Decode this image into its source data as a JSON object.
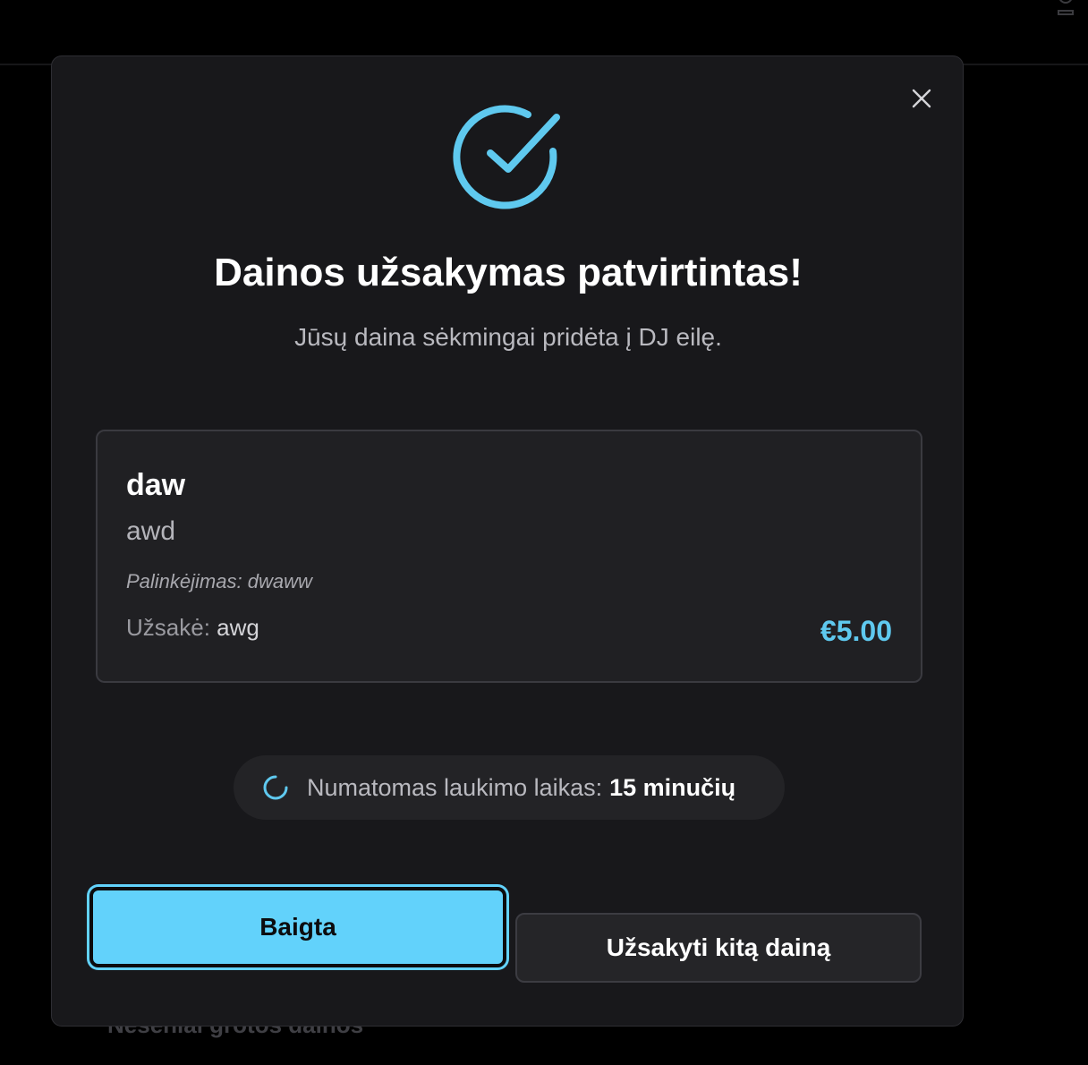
{
  "background": {
    "behind_text": "Neseniai grotos dainos"
  },
  "modal": {
    "close_icon": "close-icon",
    "success_icon": "check-circle-icon",
    "title": "Dainos užsakymas patvirtintas!",
    "subtitle": "Jūsų daina sėkmingai pridėta į DJ eilę.",
    "song": {
      "title": "daw",
      "artist": "awd",
      "dedication": "Palinkėjimas: dwaww",
      "orderer_label": "Užsakė:",
      "orderer_name": "awg",
      "price": "€5.00"
    },
    "wait": {
      "icon": "loading-spinner-icon",
      "label": "Numatomas laukimo laikas:",
      "value": "15 minučių"
    },
    "buttons": {
      "done": "Baigta",
      "order_another": "Užsakyti kitą dainą"
    }
  },
  "colors": {
    "accent": "#62d2fb",
    "price": "#5fc9ef",
    "modal_bg": "#18181b",
    "card_bg": "#202023"
  }
}
